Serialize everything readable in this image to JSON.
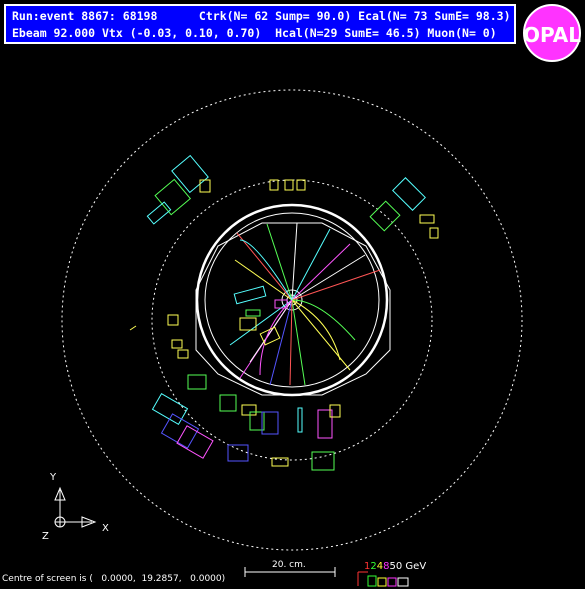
{
  "header": {
    "line1": "Run:event 8867: 68198      Ctrk(N= 62 Sump= 90.0) Ecal(N= 73 SumE= 98.3)",
    "line2": "Ebeam 92.000 Vtx (-0.03, 0.10, 0.70)  Hcal(N=29 SumE= 46.5) Muon(N= 0)"
  },
  "logo": {
    "text": "OPAL"
  },
  "axes": {
    "y": "Y",
    "x": "X",
    "z": "Z"
  },
  "scale": {
    "label": "20. cm."
  },
  "energy_legend": {
    "items": [
      {
        "text": "1",
        "color": "#ff3333"
      },
      {
        "text": "2",
        "color": "#33ff33"
      },
      {
        "text": "4",
        "color": "#ffff33"
      },
      {
        "text": "8",
        "color": "#ff33ff"
      },
      {
        "text": "50",
        "color": "#ffffff"
      },
      {
        "text": " GeV",
        "color": "#ffffff"
      }
    ]
  },
  "footer": {
    "centre": "Centre of screen is (   0.0000,  19.2857,   0.0000)"
  },
  "colors": {
    "track": [
      "#ffffff",
      "#ff5555",
      "#55ff55",
      "#ffff55",
      "#ff55ff",
      "#55ffff",
      "#5555ff"
    ]
  }
}
